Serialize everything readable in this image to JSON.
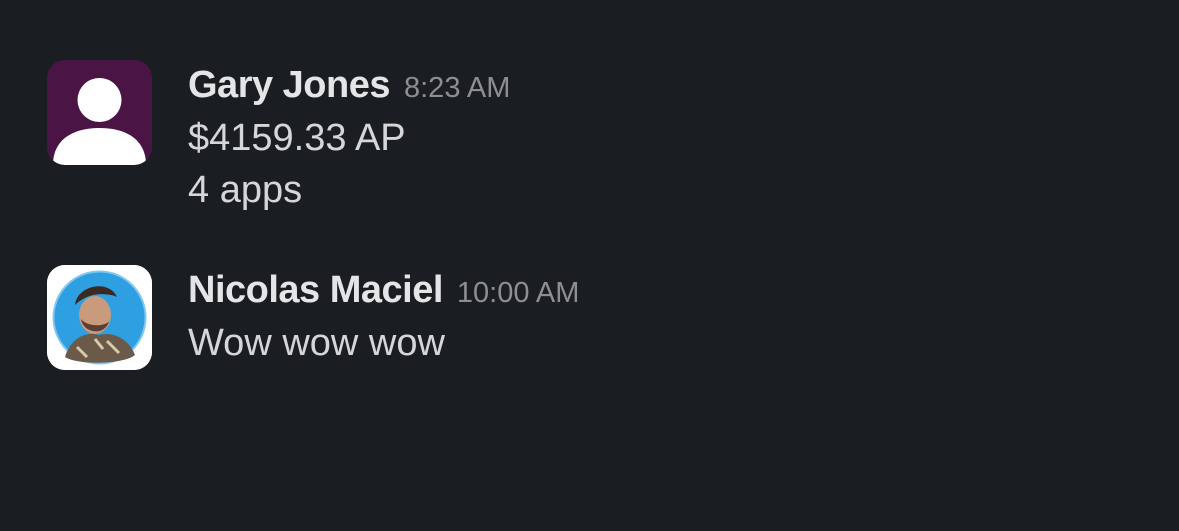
{
  "messages": [
    {
      "sender": "Gary Jones",
      "time": "8:23 AM",
      "avatar_icon": "default-user-avatar-icon",
      "avatar_color": "#4a1545",
      "lines": [
        "$4159.33 AP",
        "4 apps"
      ]
    },
    {
      "sender": "Nicolas Maciel",
      "time": "10:00 AM",
      "avatar_icon": "user-photo-avatar",
      "avatar_color": "#2e9fe0",
      "lines": [
        "Wow wow wow"
      ]
    }
  ]
}
